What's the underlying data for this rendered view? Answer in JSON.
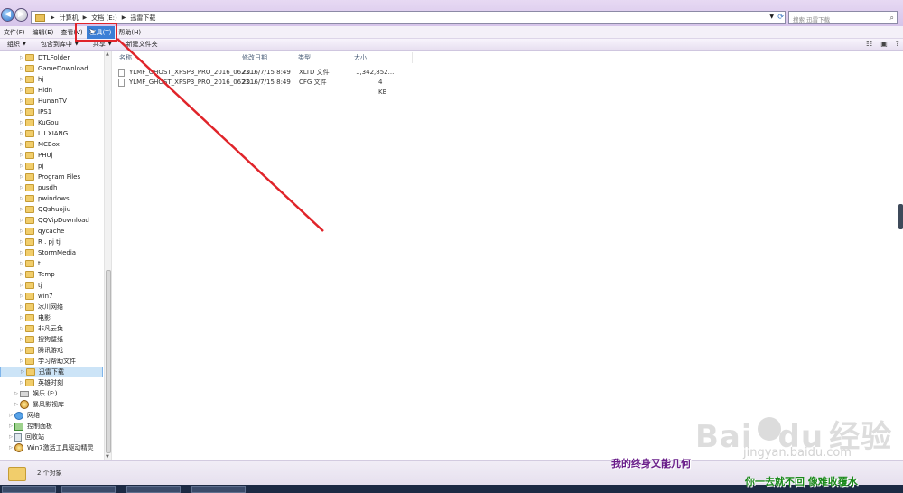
{
  "address": {
    "crumbs": [
      "计算机",
      "文档 (E:)",
      "迅雷下载"
    ],
    "search_placeholder": "搜索 迅雷下载"
  },
  "menubar": {
    "items": [
      "文件(F)",
      "编辑(E)",
      "查看(V)",
      "工具(T)",
      "帮助(H)"
    ]
  },
  "toolbar": {
    "items": [
      "组织",
      "包含到库中",
      "共享",
      "新建文件夹"
    ]
  },
  "nav": {
    "items": [
      {
        "label": "DTLFolder",
        "icon": "folder-icon"
      },
      {
        "label": "GameDownload",
        "icon": "folder-icon"
      },
      {
        "label": "hj",
        "icon": "folder-icon"
      },
      {
        "label": "Hldn",
        "icon": "folder-icon"
      },
      {
        "label": "HunanTV",
        "icon": "folder-icon"
      },
      {
        "label": "IPS1",
        "icon": "folder-icon"
      },
      {
        "label": "KuGou",
        "icon": "folder-icon"
      },
      {
        "label": "LU XIANG",
        "icon": "folder-icon"
      },
      {
        "label": "MCBox",
        "icon": "folder-icon"
      },
      {
        "label": "PHUj",
        "icon": "folder-icon"
      },
      {
        "label": "pj",
        "icon": "folder-icon"
      },
      {
        "label": "Program Files",
        "icon": "folder-icon"
      },
      {
        "label": "pusdh",
        "icon": "folder-icon"
      },
      {
        "label": "pwindows",
        "icon": "folder-icon"
      },
      {
        "label": "QQshuojiu",
        "icon": "folder-icon"
      },
      {
        "label": "QQVipDownload",
        "icon": "folder-icon"
      },
      {
        "label": "qycache",
        "icon": "folder-icon"
      },
      {
        "label": "R . pj tj",
        "icon": "folder-icon"
      },
      {
        "label": "StormMedia",
        "icon": "folder-icon"
      },
      {
        "label": "t",
        "icon": "folder-icon"
      },
      {
        "label": "Temp",
        "icon": "folder-icon"
      },
      {
        "label": "tj",
        "icon": "folder-icon"
      },
      {
        "label": "win7",
        "icon": "folder-icon"
      },
      {
        "label": "冰川网络",
        "icon": "folder-icon"
      },
      {
        "label": "电影",
        "icon": "folder-icon"
      },
      {
        "label": "非凡云免",
        "icon": "folder-icon"
      },
      {
        "label": "搜狗壁纸",
        "icon": "folder-icon"
      },
      {
        "label": "腾讯游戏",
        "icon": "folder-icon"
      },
      {
        "label": "学习帮助文件",
        "icon": "folder-icon"
      },
      {
        "label": "迅雷下载",
        "icon": "folder-icon",
        "selected": true
      },
      {
        "label": "英雄时刻",
        "icon": "folder-icon"
      },
      {
        "label": "娱乐 (F:)",
        "icon": "drive-icon"
      },
      {
        "label": "暴风影视库",
        "icon": "media-library-icon"
      },
      {
        "label": "网络",
        "icon": "network-icon"
      },
      {
        "label": "控制面板",
        "icon": "control-panel-icon"
      },
      {
        "label": "回收站",
        "icon": "recycle-bin-icon"
      },
      {
        "label": "Win7激活工具驱动精灵",
        "icon": "app-icon"
      }
    ]
  },
  "columns": {
    "name": "名称",
    "date": "修改日期",
    "type": "类型",
    "size": "大小"
  },
  "files": [
    {
      "name": "YLMF_GHOST_XPSP3_PRO_2016_0623...",
      "date": "2016/7/15 8:49",
      "type": "XLTD 文件",
      "size": "1,342,852..."
    },
    {
      "name": "YLMF_GHOST_XPSP3_PRO_2016_0623...",
      "date": "2016/7/15 8:49",
      "type": "CFG 文件",
      "size": "4 KB"
    }
  ],
  "status": {
    "count": "2 个对象"
  },
  "watermark": {
    "brand": "Bai",
    "brand2": "du",
    "brand_cn": "经验",
    "url": "jingyan.baidu.com"
  },
  "captions": {
    "line1": "我的终身又能几何",
    "line2": "你一去就不回 像难收覆水"
  },
  "colors": {
    "highlight": "#e0242a",
    "selected_nav": "#cce4f7",
    "menu_hot": "#3b7fd6"
  }
}
